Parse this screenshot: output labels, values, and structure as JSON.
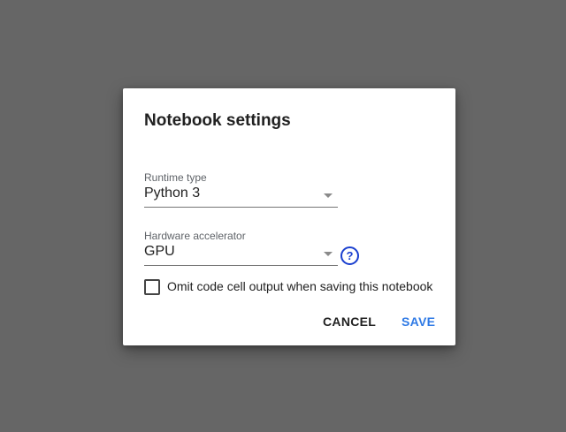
{
  "dialog": {
    "title": "Notebook settings",
    "runtime": {
      "label": "Runtime type",
      "value": "Python 3"
    },
    "accelerator": {
      "label": "Hardware accelerator",
      "value": "GPU",
      "help_icon": "help-circle-icon",
      "help_glyph": "?"
    },
    "omit_output": {
      "label": "Omit code cell output when saving this notebook",
      "checked": false
    },
    "buttons": {
      "cancel": "CANCEL",
      "save": "SAVE"
    }
  },
  "colors": {
    "backdrop": "#666666",
    "accent": "#2f7ae5",
    "help": "#1a3fcf"
  }
}
